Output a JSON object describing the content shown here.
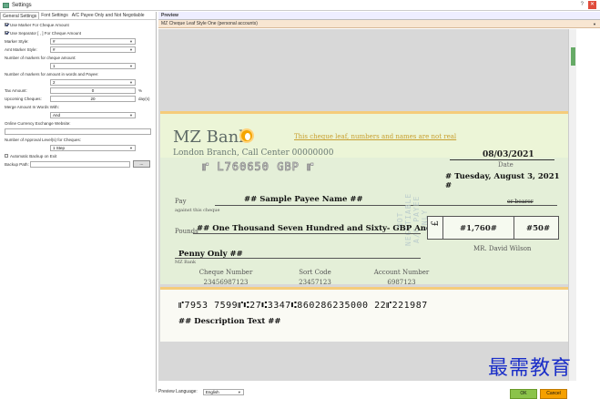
{
  "window": {
    "title": "Settings",
    "help": "?",
    "close": "✕"
  },
  "tabs": [
    {
      "label": "General Settings"
    },
    {
      "label": "Font Settings"
    },
    {
      "label": "A/C Payee Only and Not Negotiable"
    }
  ],
  "form": {
    "use_marker": "Use Marker For Cheque Amount",
    "use_separator": "Use Separator [ , ] For Cheque Amount",
    "marker_style_label": "Marker Style:",
    "marker_style_value": "#",
    "amt_marker_style_label": "Amt Marker Style:",
    "amt_marker_style_value": "#",
    "num_markers_amount_label": "Number of markers for cheque amount:",
    "num_markers_amount_value": "1",
    "num_markers_words_label": "Number of markers for amount in words and Payee:",
    "num_markers_words_value": "2",
    "tax_label": "Tax Amount:",
    "tax_value": "0",
    "tax_unit": "%",
    "upcoming_label": "Upcoming Cheques:",
    "upcoming_value": "20",
    "upcoming_unit": "day(s)",
    "merge_label": "Merge Amount In Words With:",
    "merge_value": "And",
    "currency_label": "Online Currency Exchange Website:",
    "currency_value": "",
    "approval_label": "Number of Approval Level(s) for Cheques:",
    "approval_value": "1 Step",
    "auto_backup": "Automatic Backup on Exit",
    "backup_label": "Backup Path:",
    "backup_value": "",
    "browse": "..."
  },
  "preview": {
    "header": "Preview",
    "style": "MZ Cheque Leaf Style One (personal accounts)",
    "language_label": "Preview Language:",
    "language_value": "English"
  },
  "cheque": {
    "bank": "MZ Bank",
    "branch": "London Branch, Call Center 00000000",
    "micr_top": "⑈ L760650 GBP ⑈",
    "note": "This cheque leaf, numbers and names are not real",
    "date": "08/03/2021",
    "date_label": "Date",
    "long_date": "# Tuesday, August 3, 2021 #",
    "pay": "Pay",
    "against": "against this cheque",
    "payee": "## Sample Payee Name ##",
    "bearer": "or bearer",
    "vertical": "NOT NEGOTIABLE A/C PAYEE ONLY",
    "pounds": "Pounds",
    "words1": "## One Thousand Seven Hundred and Sixty- GBP And Fifty",
    "words2": "Penny Only ##",
    "bank_small": "MZ Bank",
    "currency": "£",
    "amount": "#1,760#",
    "pence": "#50#",
    "signer": "MR. David Wilson",
    "cheque_number_label": "Cheque Number",
    "cheque_number": "23456987123",
    "sort_code_label": "Sort Code",
    "sort_code": "23457123",
    "account_number_label": "Account Number",
    "account_number": "6987123",
    "micr_bottom": "⑈7953 7599⑈⑆27⑆3347⑆860286235000 22⑈221987",
    "description": "## Description Text ##"
  },
  "buttons": {
    "ok": "OK",
    "cancel": "Cancel"
  },
  "watermark": "最需教育"
}
